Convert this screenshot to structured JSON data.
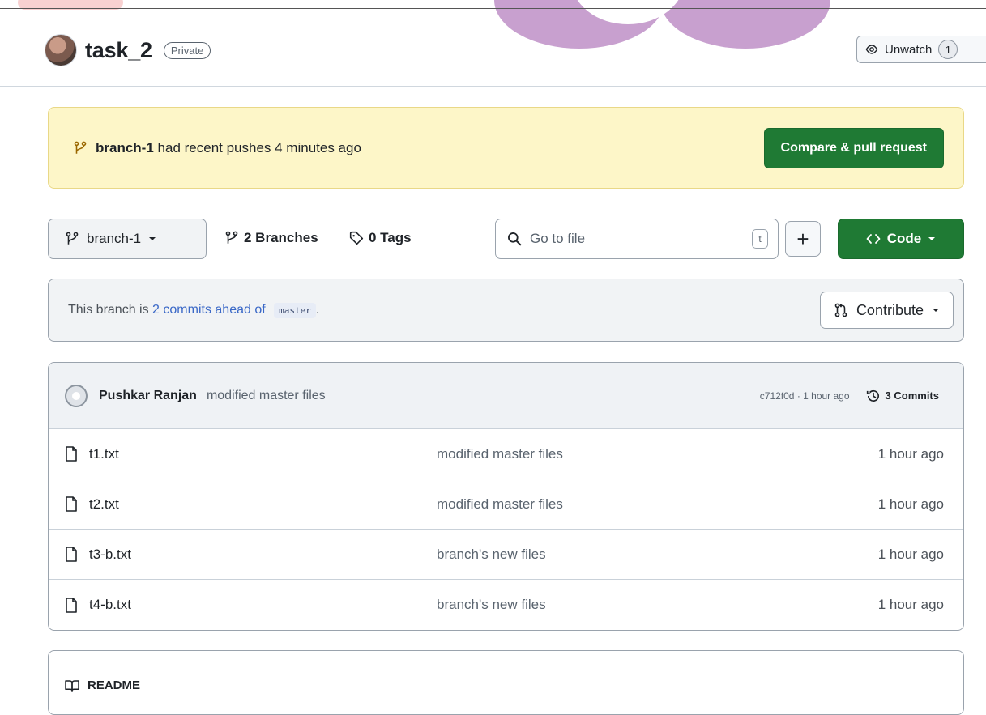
{
  "repo": {
    "name": "task_2",
    "visibility": "Private",
    "watch_label": "Unwatch",
    "watch_count": "1"
  },
  "banner": {
    "branch": "branch-1",
    "message": "had recent pushes 4 minutes ago",
    "compare_label": "Compare & pull request"
  },
  "toolbar": {
    "branch_name": "branch-1",
    "branches_label": "2 Branches",
    "tags_label": "0 Tags",
    "search_placeholder": "Go to file",
    "search_shortcut": "t",
    "add_label": "+",
    "code_label": "Code"
  },
  "ahead": {
    "prefix": "This branch is",
    "link": "2 commits ahead of",
    "base": "master",
    "suffix": ".",
    "contribute_label": "Contribute"
  },
  "latest_commit": {
    "author": "Pushkar Ranjan",
    "message": "modified master files",
    "meta": "c712f0d · 1 hour ago",
    "commits_label": "3 Commits"
  },
  "files": [
    {
      "name": "t1.txt",
      "commit": "modified master files",
      "time": "1 hour ago"
    },
    {
      "name": "t2.txt",
      "commit": "modified master files",
      "time": "1 hour ago"
    },
    {
      "name": "t3-b.txt",
      "commit": "branch's new files",
      "time": "1 hour ago"
    },
    {
      "name": "t4-b.txt",
      "commit": "branch's new files",
      "time": "1 hour ago"
    }
  ],
  "readme": {
    "title": "README"
  },
  "colors": {
    "primary_green": "#1f7a34",
    "banner_yellow": "#fdf6c8",
    "link_blue": "#3a68c7"
  }
}
